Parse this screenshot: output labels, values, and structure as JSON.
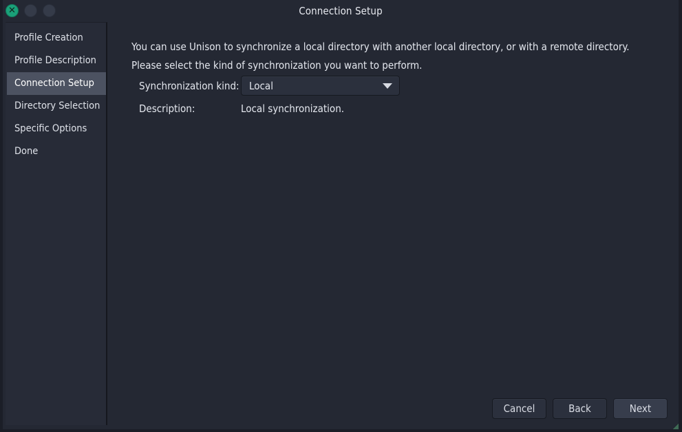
{
  "window": {
    "title": "Connection Setup",
    "controls": [
      {
        "name": "close",
        "glyph": "✕",
        "color": "#1aa179"
      },
      {
        "name": "minimize",
        "glyph": "",
        "color": "#353b49"
      },
      {
        "name": "maximize",
        "glyph": "",
        "color": "#353b49"
      }
    ]
  },
  "sidebar": {
    "items": [
      {
        "label": "Profile Creation",
        "selected": false
      },
      {
        "label": "Profile Description",
        "selected": false
      },
      {
        "label": "Connection Setup",
        "selected": true
      },
      {
        "label": "Directory Selection",
        "selected": false
      },
      {
        "label": "Specific Options",
        "selected": false
      },
      {
        "label": "Done",
        "selected": false
      }
    ]
  },
  "main": {
    "intro_line1": "You can use Unison to synchronize a local directory with another local directory, or with a remote directory.",
    "intro_line2": "Please select the kind of synchronization you want to perform.",
    "kind_label": "Synchronization kind:",
    "kind_value": "Local",
    "kind_options": [
      "Local"
    ],
    "description_label": "Description:",
    "description_value": "Local synchronization."
  },
  "footer": {
    "cancel_label": "Cancel",
    "back_label": "Back",
    "next_label": "Next"
  },
  "colors": {
    "window_bg": "#242833",
    "sidebar_bg": "#272b37",
    "selection": "#4c5261",
    "accent": "#1aa179",
    "text": "#e4e7ee"
  }
}
